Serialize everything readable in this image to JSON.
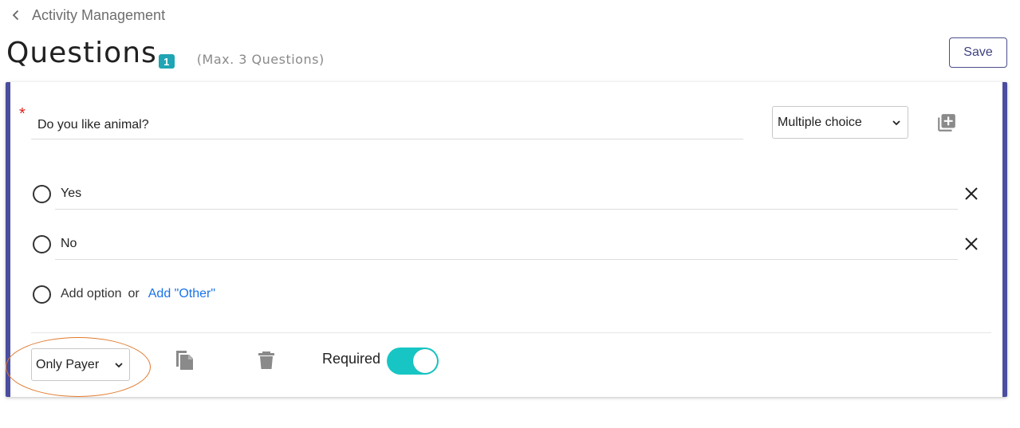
{
  "breadcrumb": {
    "back_icon": "chevron-left-icon",
    "label": "Activity Management"
  },
  "header": {
    "title": "Questions",
    "count_badge": "1",
    "max_note": "(Max. 3 Questions)",
    "save_label": "Save"
  },
  "question": {
    "required_marker": "*",
    "text": "Do you like animal?",
    "type_selected": "Multiple choice",
    "add_icon": "add-box-icon",
    "options": [
      {
        "label": "Yes",
        "remove_icon": "close-icon"
      },
      {
        "label": "No",
        "remove_icon": "close-icon"
      }
    ],
    "add_option_label": "Add option",
    "or_label": "or",
    "add_other_label": "Add \"Other\"",
    "audience_selected": "Only Payer",
    "required_label": "Required",
    "required_on": true,
    "copy_icon": "copy-icon",
    "delete_icon": "trash-icon"
  },
  "colors": {
    "accent": "#4b4d9e",
    "badge": "#1fa5b3",
    "toggle_on": "#17c6c4",
    "link": "#1a73e8",
    "required_star": "#e02020",
    "highlight": "#e07a2e"
  }
}
